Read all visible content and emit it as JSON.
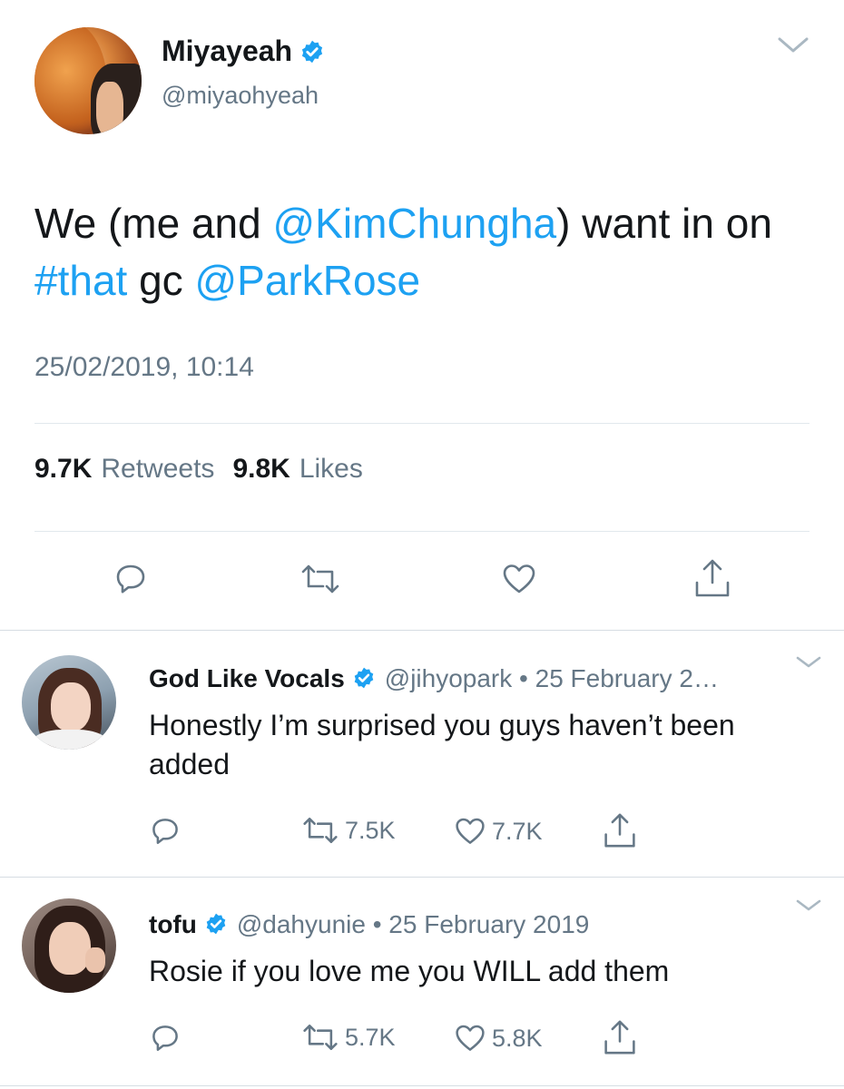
{
  "tweet": {
    "author_name": "Miyayeah",
    "author_handle": "@miyaohyeah",
    "text_parts": {
      "p1": "We (me and ",
      "mention1": "@KimChungha",
      "p2": ") want in on ",
      "hashtag": "#that",
      "p3": " gc ",
      "mention2": "@ParkRose"
    },
    "timestamp": "25/02/2019, 10:14",
    "retweets_count": "9.7K",
    "retweets_label": "Retweets",
    "likes_count": "9.8K",
    "likes_label": "Likes"
  },
  "replies": [
    {
      "name": "God Like Vocals",
      "meta": "@jihyopark • 25 February 2…",
      "text": "Honestly I’m surprised you guys haven’t been added",
      "retweets": "7.5K",
      "likes": "7.7K"
    },
    {
      "name": "tofu",
      "meta": "@dahyunie • 25 February 2019",
      "text": "Rosie if you love me you WILL add them",
      "retweets": "5.7K",
      "likes": "5.8K"
    }
  ],
  "colors": {
    "accent": "#1da1f2",
    "secondary_text": "#657786",
    "primary_text": "#14171a"
  },
  "icons": [
    "reply-icon",
    "retweet-icon",
    "like-icon",
    "share-icon",
    "verified-icon",
    "chevron-down-icon"
  ]
}
